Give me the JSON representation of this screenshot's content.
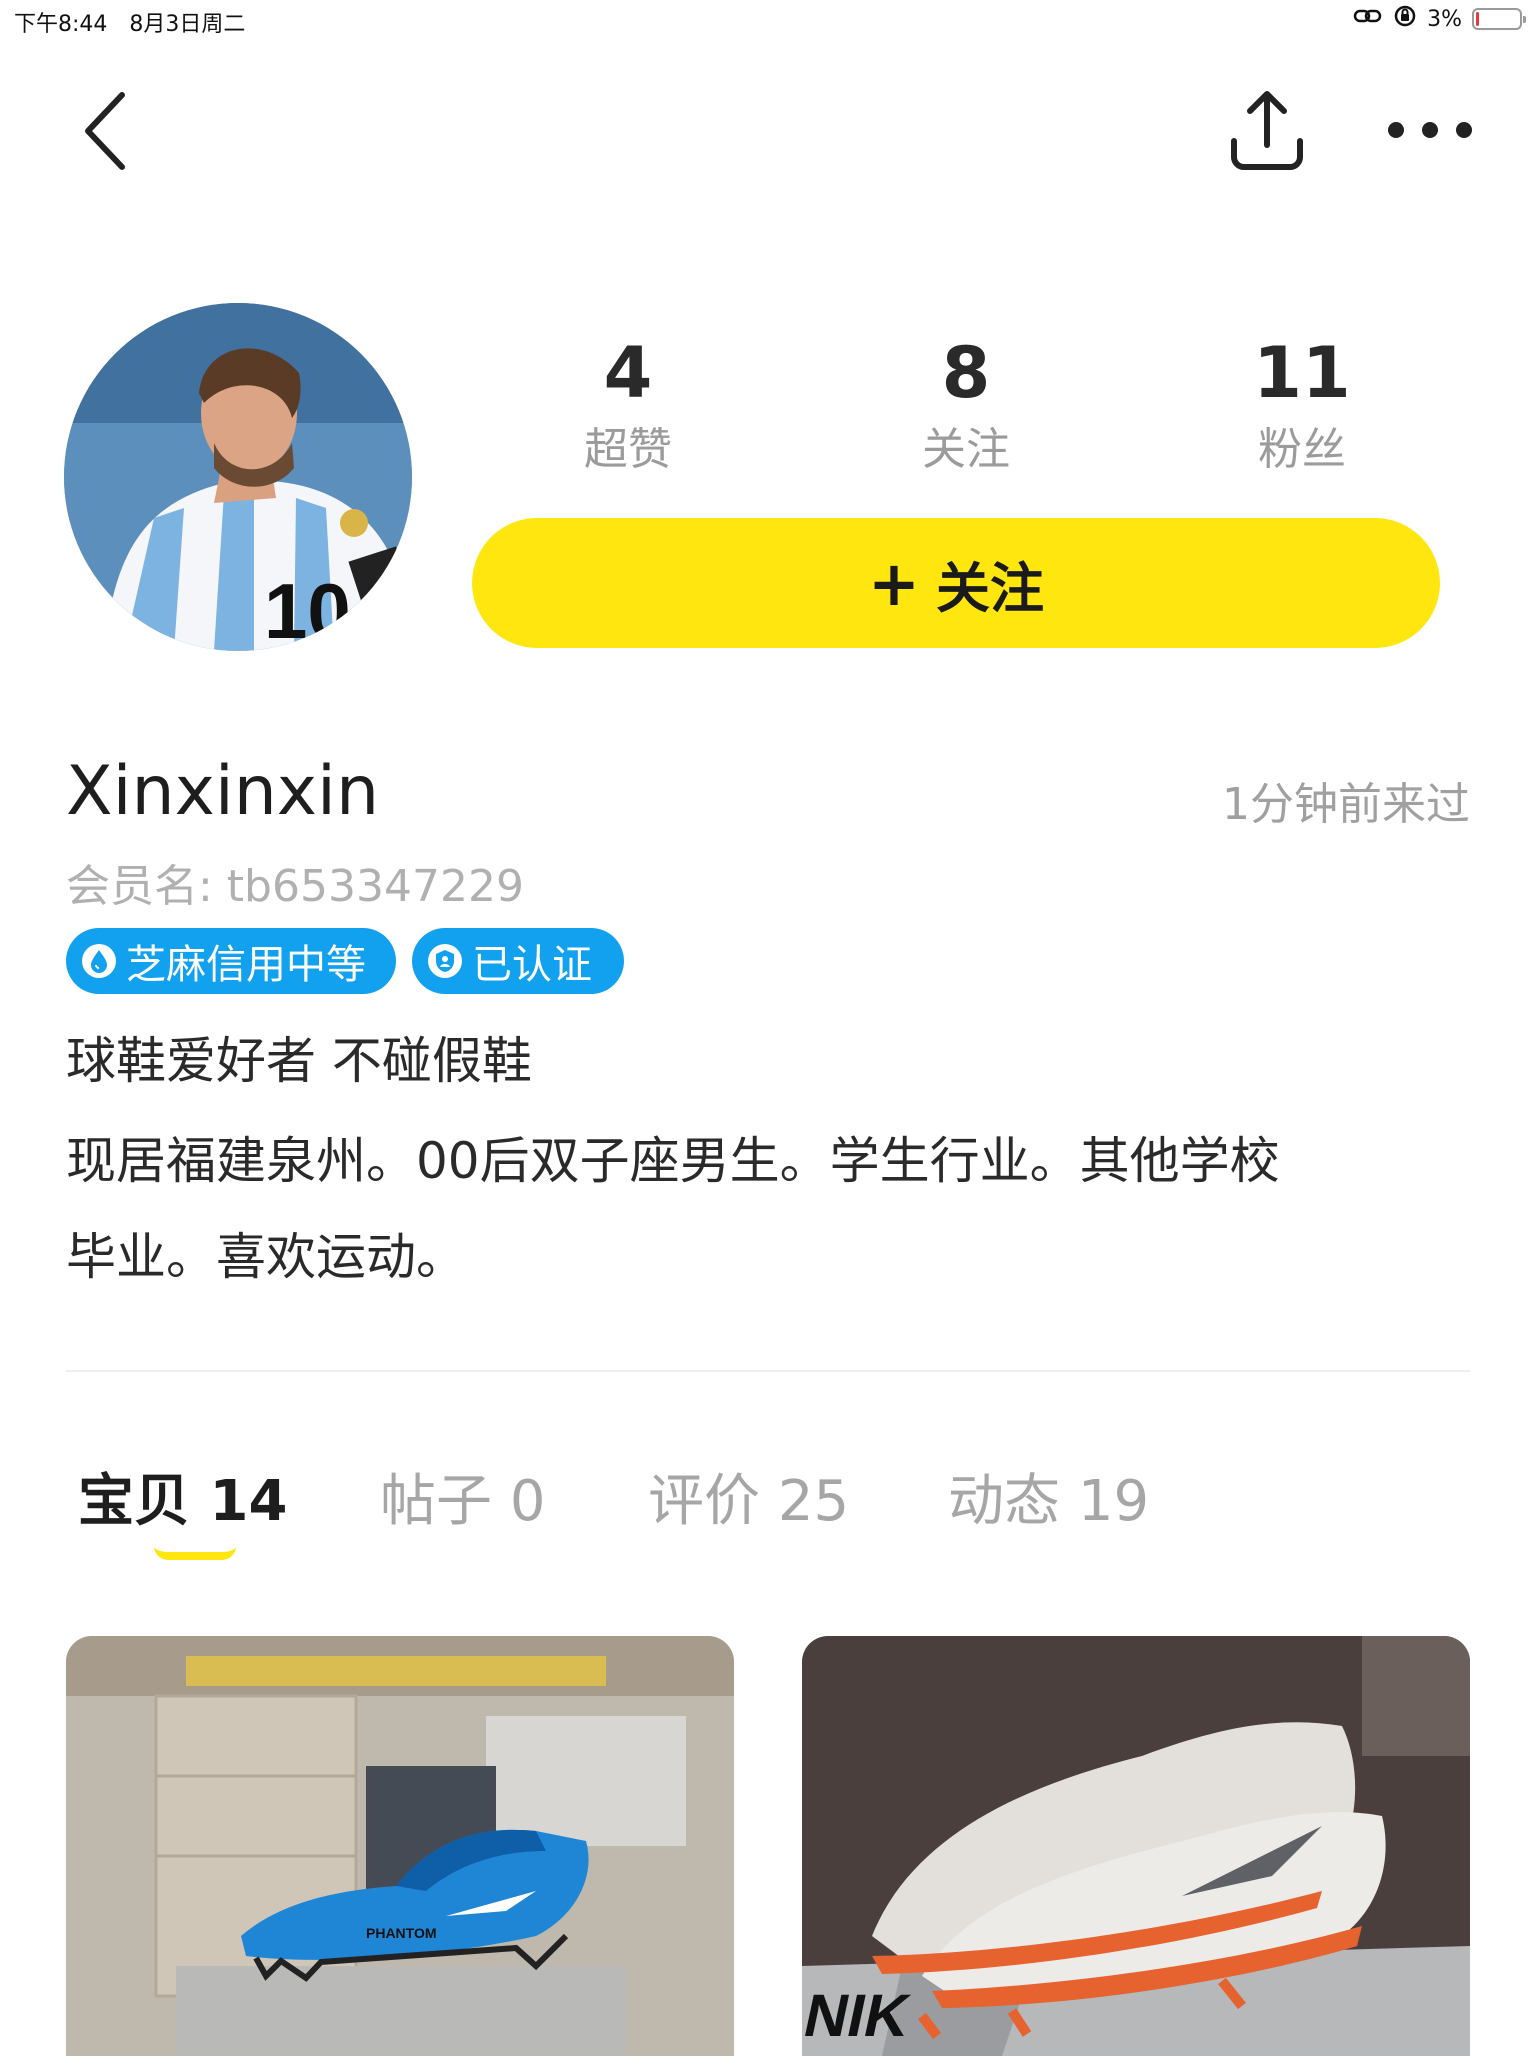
{
  "status_bar": {
    "time": "下午8:44",
    "date": "8月3日周二",
    "battery_text": "3%",
    "battery_level": 0.03
  },
  "nav": {
    "back_icon": "chevron-left-icon",
    "share_icon": "share-icon",
    "more_icon": "more-dots-icon"
  },
  "profile": {
    "stats": [
      {
        "value": "4",
        "label": "超赞"
      },
      {
        "value": "8",
        "label": "关注"
      },
      {
        "value": "11",
        "label": "粉丝"
      }
    ],
    "follow_button": {
      "plus": "+",
      "label": "关注"
    },
    "avatar_jersey_number": "10",
    "username": "Xinxinxin",
    "last_seen": "1分钟前来过",
    "member_name": "会员名: tb653347229",
    "badges": [
      {
        "label": "芝麻信用中等",
        "icon": "sesame-drop-icon"
      },
      {
        "label": "已认证",
        "icon": "verified-shield-icon"
      }
    ],
    "bio_lines": [
      "球鞋爱好者 不碰假鞋",
      "现居福建泉州。00后双子座男生。学生行业。其他学校",
      "毕业。喜欢运动。"
    ]
  },
  "tabs": [
    {
      "name": "宝贝",
      "count": "14",
      "active": true
    },
    {
      "name": "帖子",
      "count": "0",
      "active": false
    },
    {
      "name": "评价",
      "count": "25",
      "active": false
    },
    {
      "name": "动态",
      "count": "19",
      "active": false
    }
  ],
  "items": [
    {
      "kind": "blue football boot photo",
      "shoe_text": "PHANTOM"
    },
    {
      "kind": "white orange football boot photo",
      "box_text": "NIK"
    }
  ],
  "colors": {
    "accent_yellow": "#ffe60f",
    "badge_blue": "#12a1ee",
    "text_dark": "#1e1e1e",
    "text_gray": "#a6a6a6"
  }
}
